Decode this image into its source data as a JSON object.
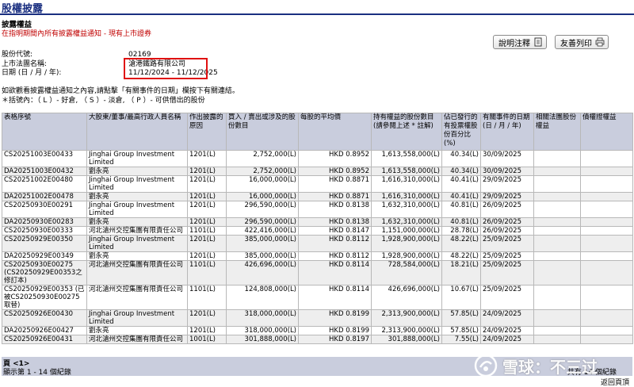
{
  "header": {
    "title": "股權披露",
    "section_title": "披露權益",
    "section_subtitle": "在指明期間內所有披露權益通知 - 現有上市證券"
  },
  "toolbar": {
    "explain_label": "說明注釋",
    "print_label": "友善列印"
  },
  "info": [
    {
      "label": "股份代號:",
      "value": "02169"
    },
    {
      "label": "上市法團名稱:",
      "value": "滄港鐵路有限公司"
    },
    {
      "label": "日期 (日 / 月 / 年):",
      "value": "11/12/2024 - 11/12/2025"
    }
  ],
  "notes": [
    "如欲觀看披露權益通知之內容,請點擊「有關事件的日期」欄按下有關連結。",
    "＊括號內：（ L ）- 好倉, （ S ）- 淡倉, （ P ）- 可供借出的股份"
  ],
  "table": {
    "headers": [
      "表格序號",
      "大股東/董事/最高行政人員名稱",
      "作出披露的原因",
      "買入 / 賣出或涉及的股份數目",
      "每股的平均價",
      "持有權益的股份數目(請參閱上述 * 註解)",
      "佔已發行的有投票權股份百分比(%)",
      "有關事件的日期(日 / 月 / 年)",
      "相關法團股份權益",
      "債權證權益"
    ],
    "rows": [
      [
        "CS20251003E00433",
        "Jinghai Group Investment Limited",
        "1201(L)",
        "2,752,000(L)",
        "HKD 0.8952",
        "1,613,558,000(L)",
        "40.34(L)",
        "30/09/2025",
        "",
        ""
      ],
      [
        "DA20251003E00432",
        "劉永亮",
        "1201(L)",
        "2,752,000(L)",
        "HKD 0.8952",
        "1,613,558,000(L)",
        "40.34(L)",
        "30/09/2025",
        "",
        ""
      ],
      [
        "CS20251002E00480",
        "Jinghai Group Investment Limited",
        "1201(L)",
        "16,000,000(L)",
        "HKD 0.8871",
        "1,616,310,000(L)",
        "40.41(L)",
        "29/09/2025",
        "",
        ""
      ],
      [
        "DA20251002E00478",
        "劉永亮",
        "1201(L)",
        "16,000,000(L)",
        "HKD 0.8871",
        "1,616,310,000(L)",
        "40.41(L)",
        "29/09/2025",
        "",
        ""
      ],
      [
        "CS20250930E00291",
        "Jinghai Group Investment Limited",
        "1201(L)",
        "296,590,000(L)",
        "HKD 0.8138",
        "1,632,310,000(L)",
        "40.81(L)",
        "26/09/2025",
        "",
        ""
      ],
      [
        "DA20250930E00283",
        "劉永亮",
        "1201(L)",
        "296,590,000(L)",
        "HKD 0.8138",
        "1,632,310,000(L)",
        "40.81(L)",
        "26/09/2025",
        "",
        ""
      ],
      [
        "CS20250930E00333",
        "河北滄州交控集團有限責任公司",
        "1101(L)",
        "422,416,000(L)",
        "HKD 0.8147",
        "1,151,000,000(L)",
        "28.78(L)",
        "26/09/2025",
        "",
        ""
      ],
      [
        "CS20250929E00350",
        "Jinghai Group Investment Limited",
        "1201(L)",
        "385,000,000(L)",
        "HKD 0.8112",
        "1,928,900,000(L)",
        "48.22(L)",
        "25/09/2025",
        "",
        ""
      ],
      [
        "DA20250929E00349",
        "劉永亮",
        "1201(L)",
        "385,000,000(L)",
        "HKD 0.8112",
        "1,928,900,000(L)",
        "48.22(L)",
        "25/09/2025",
        "",
        ""
      ],
      [
        "CS20250930E00275 (CS20250929E00353之修訂本)",
        "河北滄州交控集團有限責任公司",
        "1101(L)",
        "426,696,000(L)",
        "HKD 0.8114",
        "728,584,000(L)",
        "18.21(L)",
        "25/09/2025",
        "",
        ""
      ],
      [
        "CS20250929E00353 (已被CS20250930E00275取替)",
        "河北滄州交控集團有限責任公司",
        "1101(L)",
        "124,808,000(L)",
        "HKD 0.8114",
        "426,696,000(L)",
        "10.67(L)",
        "25/09/2025",
        "",
        ""
      ],
      [
        "CS20250926E00430",
        "Jinghai Group Investment Limited",
        "1201(L)",
        "318,000,000(L)",
        "HKD 0.8199",
        "2,313,900,000(L)",
        "57.85(L)",
        "24/09/2025",
        "",
        ""
      ],
      [
        "DA20250926E00427",
        "劉永亮",
        "1201(L)",
        "318,000,000(L)",
        "HKD 0.8199",
        "2,313,900,000(L)",
        "57.85(L)",
        "24/09/2025",
        "",
        ""
      ],
      [
        "CS20250926E00431",
        "河北滄州交控集團有限責任公司",
        "1001(L)",
        "301,888,000(L)",
        "HKD 0.8197",
        "301,888,000(L)",
        "7.55(L)",
        "24/09/2025",
        "",
        ""
      ]
    ]
  },
  "footer": {
    "page": "頁 <1>",
    "shown": "顯示第 1 - 14 個紀錄",
    "total": "共有 14 個紀錄",
    "back_to_top": "返回頁頂"
  },
  "watermark": {
    "text": "雪球：不三过",
    "icon": "snowball-logo-icon"
  }
}
